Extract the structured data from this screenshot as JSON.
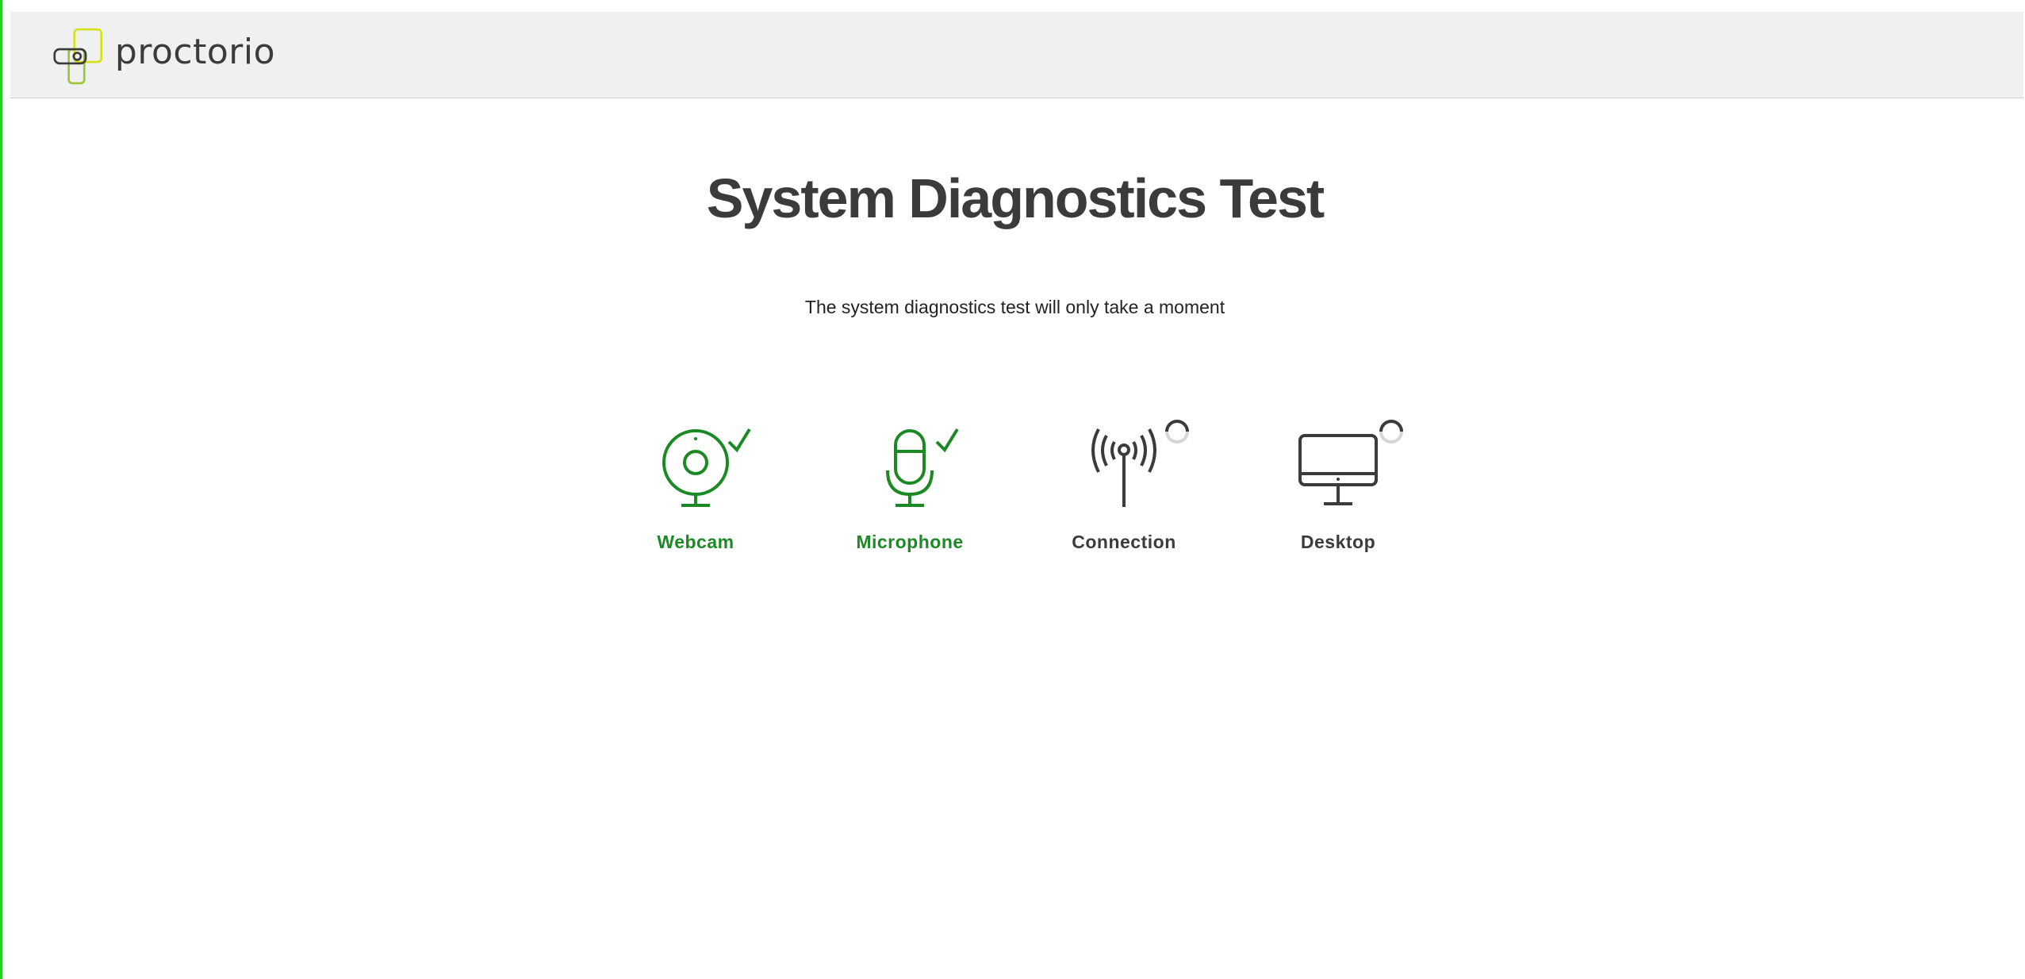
{
  "header": {
    "brand_name": "proctorio",
    "logo_icon": "proctorio-logo-icon",
    "brand_accent": "#d4e21a"
  },
  "main": {
    "title": "System Diagnostics Test",
    "subtitle": "The system diagnostics test will only take a moment"
  },
  "diagnostics": [
    {
      "label": "Webcam",
      "icon": "webcam-icon",
      "status": "passed",
      "status_icon": "checkmark-icon",
      "color": "#1b8a25"
    },
    {
      "label": "Microphone",
      "icon": "microphone-icon",
      "status": "passed",
      "status_icon": "checkmark-icon",
      "color": "#1b8a25"
    },
    {
      "label": "Connection",
      "icon": "antenna-icon",
      "status": "loading",
      "status_icon": "spinner-icon",
      "color": "#3b3b3b"
    },
    {
      "label": "Desktop",
      "icon": "monitor-icon",
      "status": "loading",
      "status_icon": "spinner-icon",
      "color": "#3b3b3b"
    }
  ]
}
